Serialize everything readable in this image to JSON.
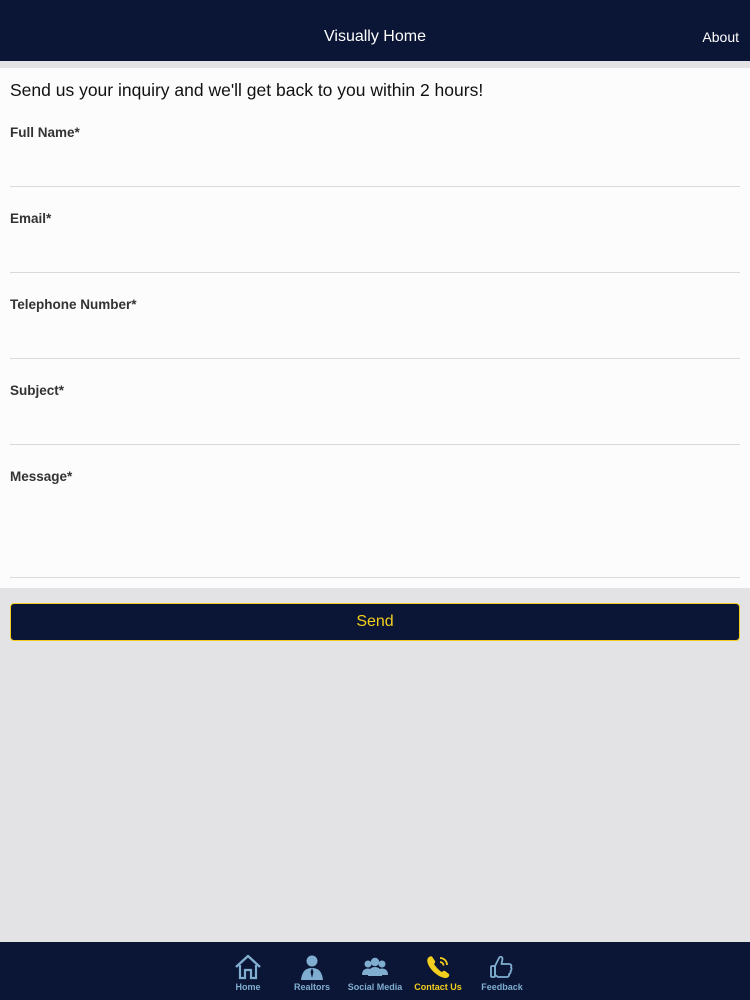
{
  "navbar": {
    "title": "Visually Home",
    "about_label": "About"
  },
  "form": {
    "intro": "Send us your inquiry and we'll get back to you within 2 hours!",
    "fields": [
      {
        "label": "Full Name*",
        "value": ""
      },
      {
        "label": "Email*",
        "value": ""
      },
      {
        "label": "Telephone Number*",
        "value": ""
      },
      {
        "label": "Subject*",
        "value": ""
      },
      {
        "label": "Message*",
        "value": ""
      }
    ],
    "send_label": "Send"
  },
  "tabbar": {
    "active": "Contact Us",
    "items": [
      {
        "label": "Home",
        "icon": "home-icon"
      },
      {
        "label": "Realtors",
        "icon": "person-icon"
      },
      {
        "label": "Social Media",
        "icon": "group-icon"
      },
      {
        "label": "Contact Us",
        "icon": "phone-icon"
      },
      {
        "label": "Feedback",
        "icon": "thumbs-up-icon"
      }
    ]
  },
  "colors": {
    "navy": "#0b1535",
    "accent_yellow": "#f2cf1e",
    "tab_inactive": "#7faed0",
    "background": "#e3e3e5"
  }
}
